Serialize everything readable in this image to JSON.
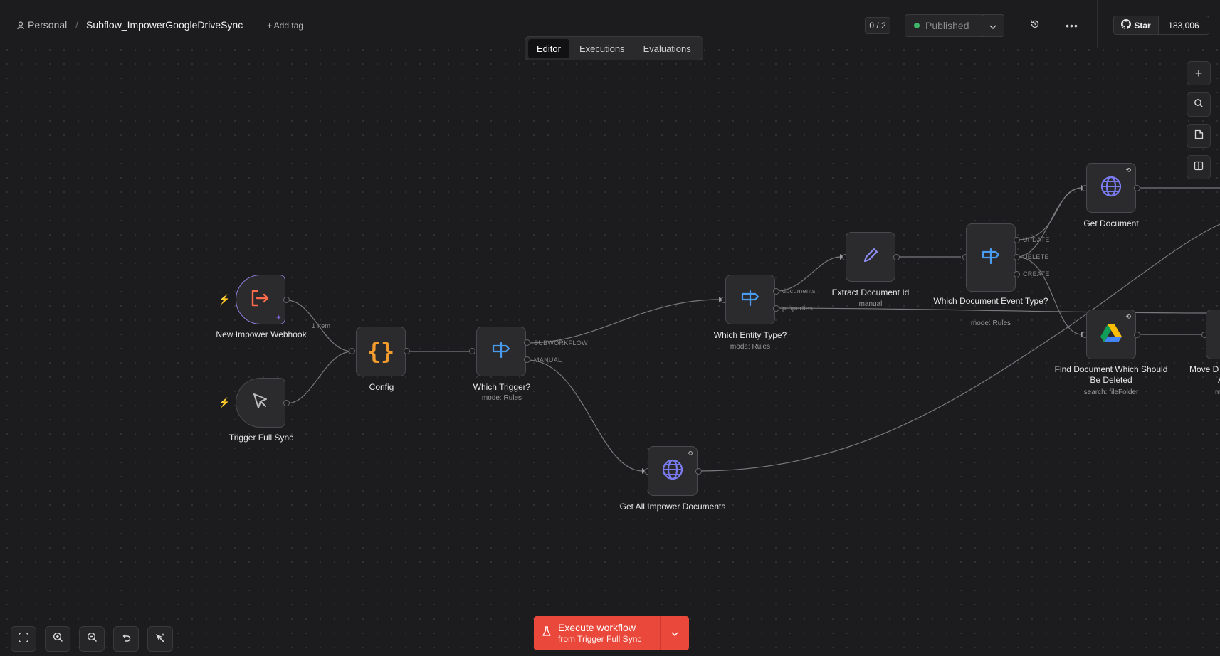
{
  "header": {
    "project": "Personal",
    "separator": "/",
    "workflow_name": "Subflow_ImpowerGoogleDriveSync",
    "add_tag": "+ Add tag",
    "version_counter": "0 / 2",
    "status": "Published",
    "github_star_label": "Star",
    "github_star_count": "183,006"
  },
  "tabs": [
    {
      "label": "Editor",
      "active": true
    },
    {
      "label": "Executions",
      "active": false
    },
    {
      "label": "Evaluations",
      "active": false
    }
  ],
  "nodes": {
    "webhook": {
      "title": "New Impower Webhook",
      "icon": "webhook-exit-icon"
    },
    "full_sync": {
      "title": "Trigger Full Sync",
      "icon": "cursor-icon"
    },
    "config": {
      "title": "Config",
      "icon": "braces-icon"
    },
    "which_trigger": {
      "title": "Which Trigger?",
      "subtitle": "mode: Rules",
      "outputs": [
        "SUBWORKFLOW",
        "MANUAL"
      ]
    },
    "which_entity": {
      "title": "Which Entity Type?",
      "subtitle": "mode: Rules",
      "outputs": [
        "documents",
        "properties"
      ]
    },
    "extract_doc": {
      "title": "Extract Document Id",
      "subtitle": "manual"
    },
    "which_event": {
      "title": "Which Document Event Type?",
      "subtitle": "mode: Rules",
      "outputs": [
        "UPDATE",
        "DELETE",
        "CREATE"
      ]
    },
    "get_document": {
      "title": "Get Document"
    },
    "find_deleted": {
      "title": "Find Document Which Should Be Deleted",
      "subtitle": "search: fileFolder"
    },
    "move_doc": {
      "title": "Move D",
      "title2": "A",
      "subtitle": "m"
    },
    "get_all": {
      "title": "Get All Impower Documents"
    }
  },
  "edge_label": "1 item",
  "execute": {
    "label": "Execute workflow",
    "sublabel": "from Trigger Full Sync"
  },
  "colors": {
    "execute_bg": "#e9483b",
    "status_dot": "#3fb56a",
    "router_blue": "#4a9cf0",
    "trigger_orange": "#ff6b4a",
    "config_orange": "#f39c2d",
    "globe_purple": "#7b7bf0"
  }
}
